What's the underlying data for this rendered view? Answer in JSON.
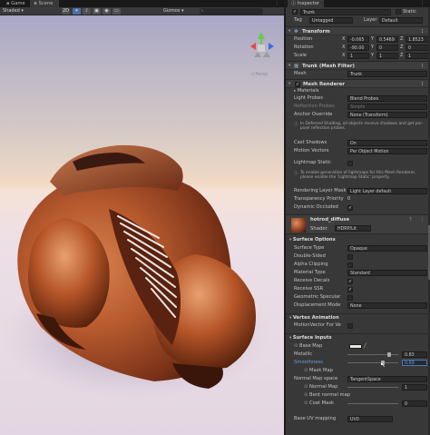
{
  "scene_tabs": [
    "Game",
    "Scene"
  ],
  "toolbar": {
    "shading": "Shaded",
    "mode2d": "2D",
    "gizmos": "Gizmos"
  },
  "viewport": {
    "persp_label": "◁ Persp"
  },
  "inspector": {
    "tab": "Inspector",
    "object_name": "Trunk",
    "static_label": "Static",
    "tag_label": "Tag",
    "tag_value": "Untagged",
    "layer_label": "Layer",
    "layer_value": "Default",
    "transform": {
      "title": "Transform",
      "position": {
        "label": "Position",
        "x": "-0.065",
        "y": "0.5469",
        "z": "1.8523"
      },
      "rotation": {
        "label": "Rotation",
        "x": "-90.00",
        "y": "0",
        "z": "0"
      },
      "scale": {
        "label": "Scale",
        "x": "1",
        "y": "1",
        "z": "1"
      }
    },
    "mesh_filter": {
      "title": "Trunk (Mesh Filter)",
      "mesh_label": "Mesh",
      "mesh_value": "Trunk"
    },
    "mesh_renderer": {
      "title": "Mesh Renderer",
      "materials": "Materials",
      "light_probes": "Light Probes",
      "light_probes_value": "Blend Probes",
      "reflection_probes": "Reflection Probes",
      "reflection_value": "Simple",
      "anchor_override": "Anchor Override",
      "anchor_value": "None (Transform)",
      "note1": "In Deferred Shading, all objects receive shadows and get per-pixel reflection probes.",
      "cast_shadows": "Cast Shadows",
      "cast_value": "On",
      "motion_vectors": "Motion Vectors",
      "motion_value": "Per Object Motion",
      "lightmap_static": "Lightmap Static",
      "note2": "To enable generation of lightmaps for this Mesh Renderer, please enable the 'Lightmap Static' property.",
      "rendering_layer": "Rendering Layer Mask",
      "rendering_value": "Light Layer default",
      "transparency": "Transparency Priority",
      "transparency_value": "0",
      "dynamic_occluded": "Dynamic Occluded"
    },
    "material": {
      "name": "hotrod_diffuse",
      "shader_label": "Shader",
      "shader_value": "HDRP/Lit"
    },
    "surface_options": {
      "title": "Surface Options",
      "surface_type": "Surface Type",
      "surface_type_value": "Opaque",
      "double_sided": "Double-Sided",
      "alpha_clipping": "Alpha Clipping",
      "material_type": "Material Type",
      "material_type_value": "Standard",
      "receive_decals": "Receive Decals",
      "receive_ssr": "Receive SSR",
      "geometric_specular": "Geometric Specular",
      "displacement": "Displacement Mode",
      "displacement_value": "None"
    },
    "vertex_animation": {
      "title": "Vertex Animation",
      "motion_vector": "MotionVector For Ve"
    },
    "surface_inputs": {
      "title": "Surface Inputs",
      "base_map": "Base Map",
      "metallic": "Metallic",
      "metallic_value": "0.83",
      "smoothness": "Smoothness",
      "smoothness_value": "0.69",
      "mask_map": "Mask Map",
      "normal_map_space": "Normal Map space",
      "normal_map_space_value": "TangentSpace",
      "normal_map": "Normal Map",
      "normal_map_value": "1",
      "bent_normal": "Bent normal map",
      "coat_mask": "Coat Mask",
      "coat_value": "0",
      "base_uv": "Base UV mapping",
      "base_uv_value": "UV0"
    },
    "metallic_fraction": 0.83,
    "smoothness_fraction": 0.69
  }
}
